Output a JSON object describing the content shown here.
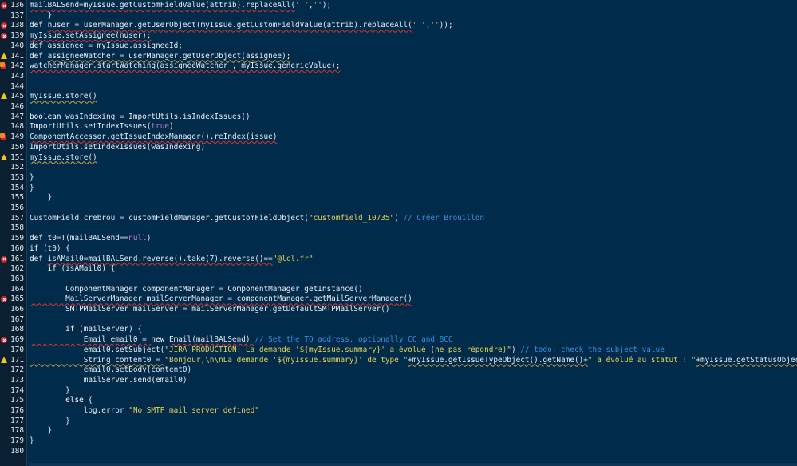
{
  "editor": {
    "colors": {
      "background": "#002b4a",
      "gutter": "#0b1f33",
      "text": "#e6ecf2",
      "string": "#e6d25a",
      "literal": "#c77ad6",
      "comment": "#3a8fe0",
      "error": "#d8232a",
      "warning": "#f5c518"
    },
    "lines": [
      {
        "num": "136",
        "marker": "error",
        "tokens": [
          {
            "t": "mailBALSend=myIssue.getCustomFieldValue(attrib).replaceAll(",
            "c": "id"
          },
          {
            "t": "' '",
            "c": "str"
          },
          {
            "t": ",",
            "c": "id"
          },
          {
            "t": "''",
            "c": "str"
          },
          {
            "t": ");",
            "c": "id"
          }
        ]
      },
      {
        "num": "137",
        "marker": "",
        "tokens": [
          {
            "t": "    }",
            "c": "id"
          }
        ]
      },
      {
        "num": "138",
        "marker": "error",
        "tokens": [
          {
            "t": "def ",
            "c": "kw"
          },
          {
            "t": "nuser = userManager.getUserObject(myIssue.getCustomFieldValue(attrib).replaceAll(",
            "c": "id"
          },
          {
            "t": "' '",
            "c": "str"
          },
          {
            "t": ",",
            "c": "id"
          },
          {
            "t": "''",
            "c": "str"
          },
          {
            "t": "));",
            "c": "id"
          }
        ]
      },
      {
        "num": "139",
        "marker": "error",
        "tokens": [
          {
            "t": "myIssue.setAssignee(nuser);",
            "c": "id"
          }
        ]
      },
      {
        "num": "140",
        "marker": "",
        "tokens": [
          {
            "t": "def ",
            "c": "kw"
          },
          {
            "t": "assignee = myIssue.assigneeId;",
            "c": "id"
          }
        ]
      },
      {
        "num": "141",
        "marker": "warning",
        "tokens": [
          {
            "t": "def ",
            "c": "kw"
          },
          {
            "t": "assigneeWatcher = userManager.getUserObject(assignee);",
            "c": "id"
          }
        ]
      },
      {
        "num": "142",
        "marker": "error-multi",
        "tokens": [
          {
            "t": "watcherManager.startWatching(assigneeWatcher , myIssue.genericValue);",
            "c": "id"
          }
        ]
      },
      {
        "num": "143",
        "marker": "",
        "tokens": []
      },
      {
        "num": "144",
        "marker": "",
        "tokens": []
      },
      {
        "num": "145",
        "marker": "warning",
        "tokens": [
          {
            "t": "myIssue.store()",
            "c": "id"
          }
        ]
      },
      {
        "num": "146",
        "marker": "",
        "tokens": []
      },
      {
        "num": "147",
        "marker": "",
        "tokens": [
          {
            "t": "boolean ",
            "c": "kw"
          },
          {
            "t": "wasIndexing = ImportUtils.isIndexIssues()",
            "c": "id"
          }
        ]
      },
      {
        "num": "148",
        "marker": "",
        "tokens": [
          {
            "t": "ImportUtils.setIndexIssues(",
            "c": "id"
          },
          {
            "t": "true",
            "c": "lit"
          },
          {
            "t": ")",
            "c": "id"
          }
        ]
      },
      {
        "num": "149",
        "marker": "error-multi",
        "tokens": [
          {
            "t": "ComponentAccessor.getIssueIndexManager().reIndex(issue)",
            "c": "id"
          }
        ]
      },
      {
        "num": "150",
        "marker": "",
        "tokens": [
          {
            "t": "ImportUtils.setIndexIssues(wasIndexing)",
            "c": "id"
          }
        ]
      },
      {
        "num": "151",
        "marker": "warning",
        "tokens": [
          {
            "t": "myIssue.store()",
            "c": "id"
          }
        ]
      },
      {
        "num": "152",
        "marker": "",
        "tokens": []
      },
      {
        "num": "153",
        "marker": "",
        "tokens": [
          {
            "t": "}",
            "c": "id"
          }
        ]
      },
      {
        "num": "154",
        "marker": "",
        "tokens": [
          {
            "t": "}",
            "c": "id"
          }
        ]
      },
      {
        "num": "155",
        "marker": "",
        "tokens": [
          {
            "t": "    }",
            "c": "id"
          }
        ]
      },
      {
        "num": "156",
        "marker": "",
        "tokens": []
      },
      {
        "num": "157",
        "marker": "",
        "tokens": [
          {
            "t": "CustomField crebrou = customFieldManager.getCustomFieldObject(",
            "c": "id"
          },
          {
            "t": "\"customfield_10735\"",
            "c": "str"
          },
          {
            "t": ") ",
            "c": "id"
          },
          {
            "t": "// Créer Brouillon",
            "c": "com"
          }
        ]
      },
      {
        "num": "158",
        "marker": "",
        "tokens": []
      },
      {
        "num": "159",
        "marker": "",
        "tokens": [
          {
            "t": "def ",
            "c": "kw"
          },
          {
            "t": "t0=!(mailBALSend==",
            "c": "id"
          },
          {
            "t": "null",
            "c": "lit"
          },
          {
            "t": ")",
            "c": "id"
          }
        ]
      },
      {
        "num": "160",
        "marker": "",
        "tokens": [
          {
            "t": "if ",
            "c": "kw"
          },
          {
            "t": "(t0) {",
            "c": "id"
          }
        ]
      },
      {
        "num": "161",
        "marker": "error",
        "tokens": [
          {
            "t": "def ",
            "c": "kw"
          },
          {
            "t": "isAMail0=mailBALSend.reverse().take(7).reverse()==",
            "c": "id"
          },
          {
            "t": "\"@lcl.fr\"",
            "c": "str"
          }
        ]
      },
      {
        "num": "162",
        "marker": "",
        "tokens": [
          {
            "t": "    if ",
            "c": "kw"
          },
          {
            "t": "(isAMail0) {",
            "c": "id"
          }
        ]
      },
      {
        "num": "163",
        "marker": "",
        "tokens": []
      },
      {
        "num": "164",
        "marker": "",
        "tokens": [
          {
            "t": "        ComponentManager componentManager = ComponentManager.getInstance()",
            "c": "id"
          }
        ]
      },
      {
        "num": "165",
        "marker": "error",
        "tokens": [
          {
            "t": "        MailServerManager mailServerManager = componentManager.getMailServerManager()",
            "c": "id"
          }
        ]
      },
      {
        "num": "166",
        "marker": "",
        "tokens": [
          {
            "t": "        SMTPMailServer mailServer = mailServerManager.getDefaultSMTPMailServer()",
            "c": "id"
          }
        ]
      },
      {
        "num": "167",
        "marker": "",
        "tokens": []
      },
      {
        "num": "168",
        "marker": "",
        "tokens": [
          {
            "t": "        if ",
            "c": "kw"
          },
          {
            "t": "(mailServer) {",
            "c": "id"
          }
        ]
      },
      {
        "num": "169",
        "marker": "error",
        "tokens": [
          {
            "t": "            Email email0 = ",
            "c": "id"
          },
          {
            "t": "new ",
            "c": "kw"
          },
          {
            "t": "Email(mailBALSend) ",
            "c": "id"
          },
          {
            "t": "// Set the TO address, optionally CC and BCC",
            "c": "com"
          }
        ]
      },
      {
        "num": "170",
        "marker": "",
        "tokens": [
          {
            "t": "            email0.setSubject(",
            "c": "id"
          },
          {
            "t": "\"JIRA PRODUCTION: La demande '${myIssue.summary}' a évolué (ne pas répondre)\"",
            "c": "str"
          },
          {
            "t": ") ",
            "c": "id"
          },
          {
            "t": "// todo: check the subject value",
            "c": "com"
          }
        ]
      },
      {
        "num": "171",
        "marker": "warning",
        "tokens": [
          {
            "t": "            String content0 = ",
            "c": "id"
          },
          {
            "t": "\"Bonjour,\\n\\nLa demande '${myIssue.summary}' de type \"",
            "c": "str"
          },
          {
            "t": "+myIssue.getIssueTypeObject().getName()+",
            "c": "id"
          },
          {
            "t": "\" a évolué au statut : \"",
            "c": "str"
          },
          {
            "t": "+myIssue.getStatusObject().getName()+\"",
            "c": "id"
          }
        ]
      },
      {
        "num": "172",
        "marker": "",
        "tokens": [
          {
            "t": "            email0.setBody(content0)",
            "c": "id"
          }
        ]
      },
      {
        "num": "173",
        "marker": "",
        "tokens": [
          {
            "t": "            mailServer.send(email0)",
            "c": "id"
          }
        ]
      },
      {
        "num": "174",
        "marker": "",
        "tokens": [
          {
            "t": "        }",
            "c": "id"
          }
        ]
      },
      {
        "num": "175",
        "marker": "",
        "tokens": [
          {
            "t": "        else ",
            "c": "kw"
          },
          {
            "t": "{",
            "c": "id"
          }
        ]
      },
      {
        "num": "176",
        "marker": "",
        "tokens": [
          {
            "t": "            log.error ",
            "c": "id"
          },
          {
            "t": "\"No SMTP mail server defined\"",
            "c": "str"
          }
        ]
      },
      {
        "num": "177",
        "marker": "",
        "tokens": [
          {
            "t": "        }",
            "c": "id"
          }
        ]
      },
      {
        "num": "178",
        "marker": "",
        "tokens": [
          {
            "t": "    }",
            "c": "id"
          }
        ]
      },
      {
        "num": "179",
        "marker": "",
        "tokens": [
          {
            "t": "}",
            "c": "id"
          }
        ]
      },
      {
        "num": "180",
        "marker": "",
        "tokens": []
      }
    ]
  }
}
